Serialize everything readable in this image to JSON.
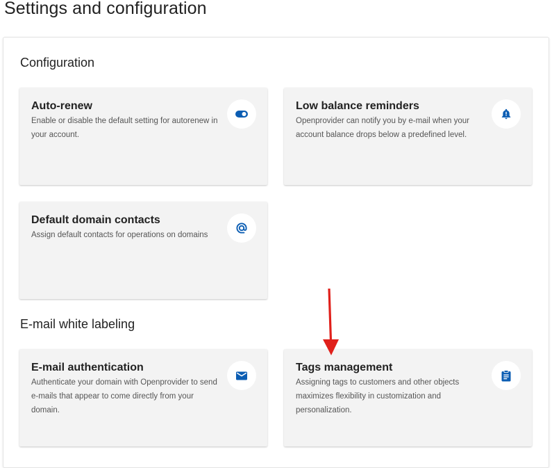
{
  "page": {
    "title": "Settings and configuration"
  },
  "sections": {
    "configuration": {
      "heading": "Configuration",
      "cards": {
        "auto_renew": {
          "title": "Auto-renew",
          "description": "Enable or disable the default setting for autorenew in your account.",
          "icon": "toggle-icon"
        },
        "low_balance": {
          "title": "Low balance reminders",
          "description": "Openprovider can notify you by e-mail when your account balance drops below a predefined level.",
          "icon": "bell-alert-icon"
        },
        "default_contacts": {
          "title": "Default domain contacts",
          "description": "Assign default contacts for operations on domains",
          "icon": "at-sign-icon"
        }
      }
    },
    "email_white_labeling": {
      "heading": "E-mail white labeling",
      "cards": {
        "email_auth": {
          "title": "E-mail authentication",
          "description": "Authenticate your domain with Openprovider to send e-mails that appear to come directly from your domain.",
          "icon": "envelope-icon"
        },
        "tags_management": {
          "title": "Tags management",
          "description": "Assigning tags to customers and other objects maximizes flexibility in customization and personalization.",
          "icon": "clipboard-icon"
        }
      }
    }
  },
  "colors": {
    "icon_blue": "#0b5db3",
    "card_bg": "#f3f3f3",
    "annotation_arrow": "#e0201b"
  }
}
